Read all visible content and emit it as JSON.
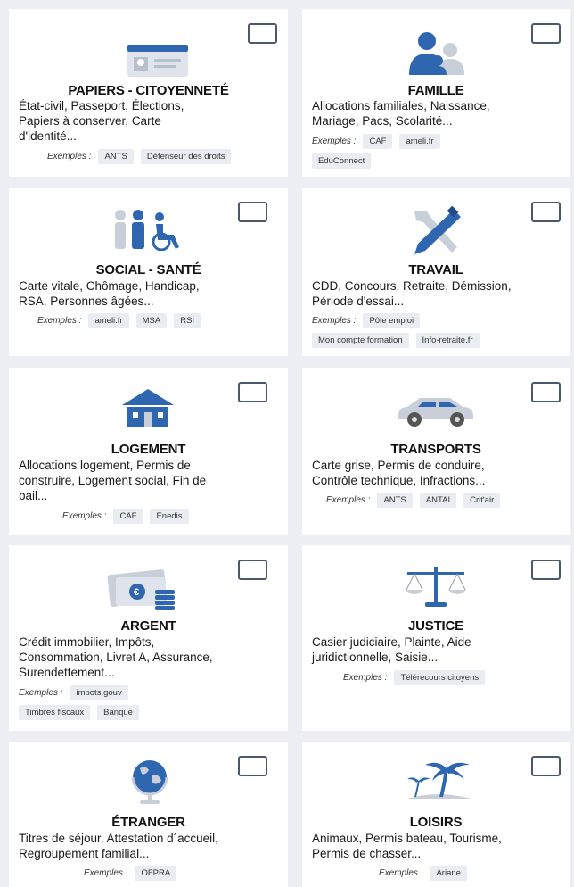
{
  "example_label": "Exemples :",
  "categories": [
    {
      "title": "PAPIERS - CITOYENNETÉ",
      "desc": [
        "État-civil, Passeport, Élections,",
        "Papiers à conserver, Carte",
        "d'identité..."
      ],
      "examples": [
        "ANTS",
        "Défenseur des droits"
      ]
    },
    {
      "title": "FAMILLE",
      "desc": [
        "Allocations familiales, Naissance,",
        "Mariage, Pacs, Scolarité..."
      ],
      "examples": [
        "CAF",
        "ameli.fr",
        "EduConnect"
      ]
    },
    {
      "title": "SOCIAL - SANTÉ",
      "desc": [
        "Carte vitale, Chômage, Handicap,",
        "RSA, Personnes âgées..."
      ],
      "examples": [
        "ameli.fr",
        "MSA",
        "RSI"
      ]
    },
    {
      "title": "TRAVAIL",
      "desc": [
        "CDD, Concours, Retraite, Démission,",
        "Période d'essai..."
      ],
      "examples": [
        "Pôle emploi",
        "Mon compte formation",
        "Info-retraite.fr"
      ]
    },
    {
      "title": "LOGEMENT",
      "desc": [
        "Allocations logement, Permis de",
        "construire, Logement social, Fin de",
        "bail..."
      ],
      "examples": [
        "CAF",
        "Enedis"
      ]
    },
    {
      "title": "TRANSPORTS",
      "desc": [
        "Carte grise, Permis de conduire,",
        "Contrôle technique, Infractions..."
      ],
      "examples": [
        "ANTS",
        "ANTAI",
        "Crit'air"
      ]
    },
    {
      "title": "ARGENT",
      "desc": [
        "Crédit immobilier, Impôts,",
        "Consommation, Livret A, Assurance,",
        "Surendettement..."
      ],
      "examples": [
        "impots.gouv",
        "Timbres fiscaux",
        "Banque"
      ]
    },
    {
      "title": "JUSTICE",
      "desc": [
        "Casier judiciaire, Plainte, Aide",
        "juridictionnelle, Saisie..."
      ],
      "examples": [
        "Télérecours citoyens"
      ]
    },
    {
      "title": "ÉTRANGER",
      "desc": [
        "Titres de séjour, Attestation d´accueil,",
        "Regroupement familial..."
      ],
      "examples": [
        "OFPRA"
      ]
    },
    {
      "title": "LOISIRS",
      "desc": [
        "Animaux, Permis bateau, Tourisme,",
        "Permis de chasser..."
      ],
      "examples": [
        "Ariane"
      ]
    }
  ],
  "colors": {
    "icon_blue": "#2f66b0",
    "icon_grey": "#c9cfd9",
    "checkbox_border": "#4a5870"
  }
}
